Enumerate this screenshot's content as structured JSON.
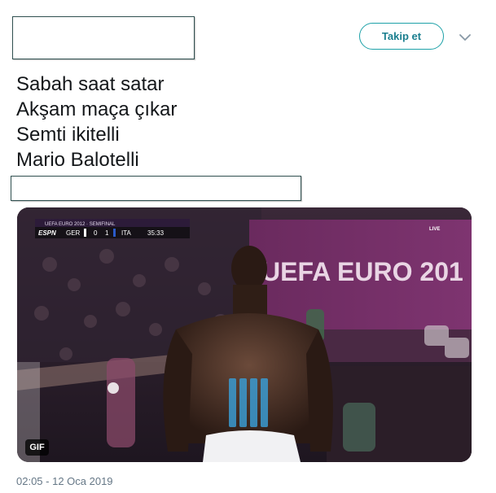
{
  "header": {
    "follow_label": "Takip et",
    "menu_icon": "chevron-down-icon"
  },
  "tweet": {
    "lines": [
      "Sabah saat satar",
      "Akşam maça çıkar",
      "Semti ikitelli",
      "Mario Balotelli"
    ]
  },
  "media": {
    "badge": "GIF",
    "scoreboard": {
      "event": "UEFA EURO 2012 · SEMIFINAL",
      "network": "ESPN",
      "team_home": "GER",
      "score_home": "0",
      "score_away": "1",
      "team_away": "ITA",
      "clock": "35:33",
      "live": "LIVE"
    },
    "banner_text": "UEFA EURO 201"
  },
  "footer": {
    "timestamp": "02:05 - 12 Oca 2019"
  },
  "colors": {
    "accent": "#1da1a8",
    "text": "#14171a",
    "muted": "#657786"
  }
}
